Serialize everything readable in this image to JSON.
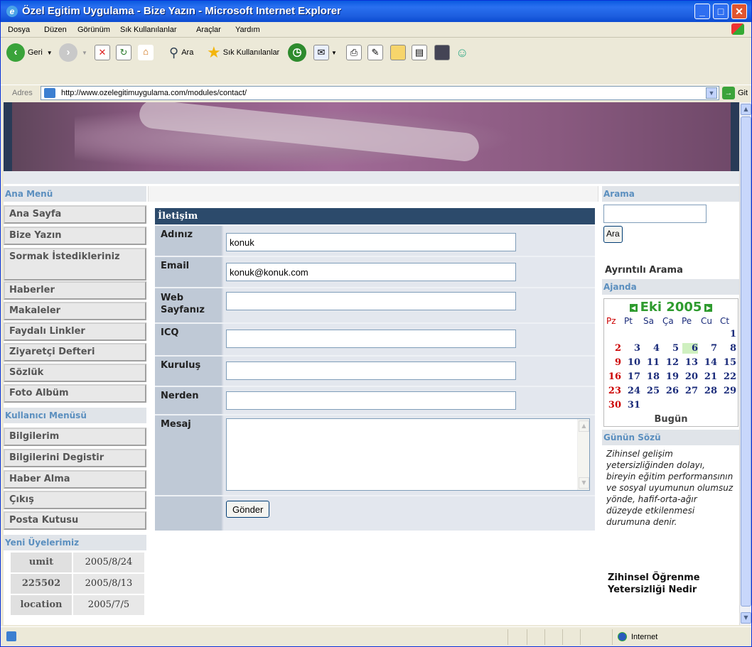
{
  "window": {
    "title": "Özel Egitim Uygulama - Bize Yazın - Microsoft Internet Explorer"
  },
  "menu": [
    "Dosya",
    "Düzen",
    "Görünüm",
    "Sık Kullanılanlar",
    "Araçlar",
    "Yardım"
  ],
  "toolbar": {
    "back": "Geri",
    "search": "Ara",
    "favorites": "Sık Kullanılanlar"
  },
  "address": {
    "label": "Adres",
    "url": "http://www.ozelegitimuygulama.com/modules/contact/",
    "go": "Git"
  },
  "left": {
    "main_menu_title": "Ana Menü",
    "main_menu": [
      "Ana Sayfa",
      "Bize Yazın",
      "Sormak İstedikleriniz",
      "Haberler",
      "Makaleler",
      "Faydalı Linkler",
      "Ziyaretçi Defteri",
      "Sözlük",
      "Foto Albüm"
    ],
    "user_menu_title": "Kullanıcı Menüsü",
    "user_menu": [
      "Bilgilerim",
      "Bilgilerini Degistir",
      "Haber Alma",
      "Çıkış",
      "Posta Kutusu"
    ],
    "new_members_title": "Yeni Üyelerimiz",
    "new_members": [
      [
        "umit",
        "2005/8/24"
      ],
      [
        "225502",
        "2005/8/13"
      ],
      [
        "location",
        "2005/7/5"
      ]
    ]
  },
  "form": {
    "title": "İletişim",
    "fields": [
      {
        "label": "Adınız",
        "value": "konuk"
      },
      {
        "label": "Email",
        "value": "konuk@konuk.com"
      },
      {
        "label": "Web Sayfanız",
        "value": ""
      },
      {
        "label": "ICQ",
        "value": ""
      },
      {
        "label": "Kuruluş",
        "value": ""
      },
      {
        "label": "Nerden",
        "value": ""
      }
    ],
    "message_label": "Mesaj",
    "submit": "Gönder"
  },
  "right": {
    "search_title": "Arama",
    "search_button": "Ara",
    "advanced": "Ayrıntılı Arama",
    "agenda_title": "Ajanda",
    "calendar": {
      "month": "Eki 2005",
      "weekdays": [
        "Pz",
        "Pt",
        "Sa",
        "Ça",
        "Pe",
        "Cu",
        "Ct"
      ],
      "today_day": 6,
      "today_label": "Bugün"
    },
    "quote_title": "Günün Sözü",
    "quote": "Zihinsel gelişim yetersizliğinden dolayı, bireyin eğitim performansının ve sosyal uyumunun olumsuz yönde, hafif-orta-ağır düzeyde etkilenmesi durumuna denir.",
    "quote_link": "Zihinsel Öğrenme Yetersizliği Nedir"
  },
  "status": {
    "zone": "Internet"
  },
  "colors": {
    "accent": "#2c4a6b",
    "section_header": "#5b8fbf",
    "calendar_green": "#2e9b2e",
    "calendar_red": "#cc0000",
    "calendar_blue": "#1a2b7a"
  }
}
